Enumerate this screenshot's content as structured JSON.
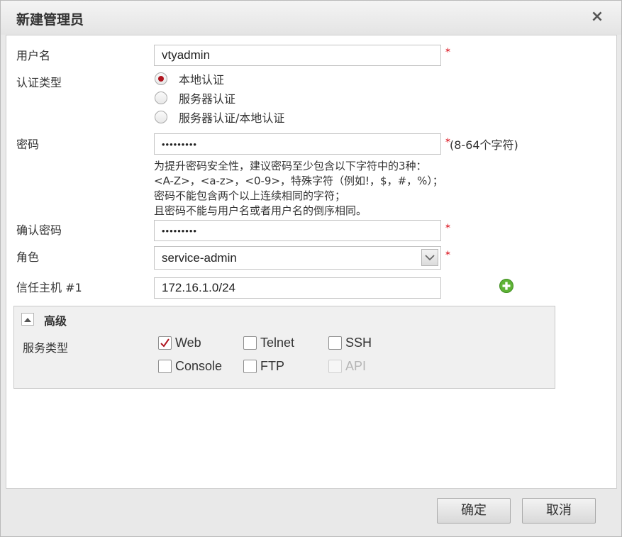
{
  "dialog": {
    "title": "新建管理员",
    "close_symbol": "×"
  },
  "form": {
    "username": {
      "label": "用户名",
      "value": "vtyadmin",
      "required_mark": "*"
    },
    "auth_type": {
      "label": "认证类型",
      "options": [
        "本地认证",
        "服务器认证",
        "服务器认证/本地认证"
      ],
      "selected": 0
    },
    "password": {
      "label": "密码",
      "value": "•••••••••",
      "required_mark": "*",
      "length_hint": "(8-64个字符)",
      "hint_lines": [
        "为提升密码安全性，建议密码至少包含以下字符中的3种：",
        "<A-Z>，<a-z>，<0-9>，特殊字符（例如!，$，#，%）；",
        "密码不能包含两个以上连续相同的字符；",
        "且密码不能与用户名或者用户名的倒序相同。"
      ]
    },
    "confirm_password": {
      "label": "确认密码",
      "value": "•••••••••",
      "required_mark": "*"
    },
    "role": {
      "label": "角色",
      "value": "service-admin",
      "required_mark": "*"
    },
    "trusted_host": {
      "label": "信任主机 #1",
      "value": "172.16.1.0/24"
    }
  },
  "advanced": {
    "title": "高级",
    "expanded": true,
    "service_type_label": "服务类型",
    "services": [
      {
        "label": "Web",
        "checked": true,
        "enabled": true
      },
      {
        "label": "Telnet",
        "checked": false,
        "enabled": true
      },
      {
        "label": "SSH",
        "checked": false,
        "enabled": true
      },
      {
        "label": "Console",
        "checked": false,
        "enabled": true
      },
      {
        "label": "FTP",
        "checked": false,
        "enabled": true
      },
      {
        "label": "API",
        "checked": false,
        "enabled": false
      }
    ]
  },
  "buttons": {
    "ok": "确定",
    "cancel": "取消"
  },
  "icons": {
    "close": "close-icon",
    "add": "plus-circle-icon",
    "dropdown": "chevron-down-icon",
    "collapse": "triangle-up-icon",
    "check": "checkmark-icon"
  },
  "colors": {
    "required": "#d8000c",
    "radio_selected": "#b0151f",
    "checkmark": "#b0151f",
    "add_icon": "#5fb336"
  }
}
